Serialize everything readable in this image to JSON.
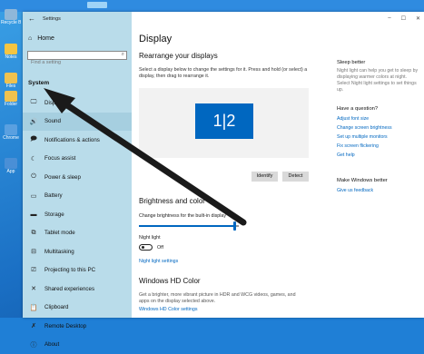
{
  "desktop": {
    "icons": [
      {
        "label": "Recycle Bin",
        "color": "#8fb7d9"
      },
      {
        "label": "Notes",
        "color": "#f5c542"
      },
      {
        "label": "Files",
        "color": "#f0c24f"
      },
      {
        "label": "Folder",
        "color": "#f0c24f"
      },
      {
        "label": "Chrome",
        "color": "#5aa0e0"
      },
      {
        "label": "App",
        "color": "#4a8fd6"
      }
    ]
  },
  "window": {
    "app_title": "Settings",
    "controls": {
      "minimize": "–",
      "maximize": "☐",
      "close": "✕"
    }
  },
  "sidebar": {
    "home_label": "Home",
    "search_placeholder": "Find a setting",
    "section_label": "System",
    "items": [
      {
        "label": "Display",
        "icon": "display-icon",
        "glyph": "🖵"
      },
      {
        "label": "Sound",
        "icon": "sound-icon",
        "glyph": "🔊"
      },
      {
        "label": "Notifications & actions",
        "icon": "notifications-icon",
        "glyph": "🗩"
      },
      {
        "label": "Focus assist",
        "icon": "moon-icon",
        "glyph": "☾"
      },
      {
        "label": "Power & sleep",
        "icon": "power-icon",
        "glyph": "⏻"
      },
      {
        "label": "Battery",
        "icon": "battery-icon",
        "glyph": "▭"
      },
      {
        "label": "Storage",
        "icon": "storage-icon",
        "glyph": "▬"
      },
      {
        "label": "Tablet mode",
        "icon": "tablet-icon",
        "glyph": "⧉"
      },
      {
        "label": "Multitasking",
        "icon": "multitasking-icon",
        "glyph": "⊟"
      },
      {
        "label": "Projecting to this PC",
        "icon": "projecting-icon",
        "glyph": "⎚"
      },
      {
        "label": "Shared experiences",
        "icon": "shared-icon",
        "glyph": "✕"
      },
      {
        "label": "Clipboard",
        "icon": "clipboard-icon",
        "glyph": "📋"
      },
      {
        "label": "Remote Desktop",
        "icon": "remote-desktop-icon",
        "glyph": "✗"
      },
      {
        "label": "About",
        "icon": "info-icon",
        "glyph": "ⓘ"
      }
    ],
    "active_index": 1
  },
  "main": {
    "title": "Display",
    "rearrange_heading": "Rearrange your displays",
    "rearrange_desc": "Select a display below to change the settings for it. Press and hold (or select) a display, then drag to rearrange it.",
    "monitor_label": "1|2",
    "identify_label": "Identify",
    "detect_label": "Detect",
    "brightness_heading": "Brightness and color",
    "brightness_label": "Change brightness for the built-in display",
    "brightness_value": 0.95,
    "night_light_label": "Night light",
    "night_light_state": "Off",
    "night_light_settings_link": "Night light settings",
    "hdr_heading": "Windows HD Color",
    "hdr_desc": "Get a brighter, more vibrant picture in HDR and WCG videos, games, and apps on the display selected above.",
    "hdr_link": "Windows HD Color settings"
  },
  "right_panel": {
    "sleep_heading": "Sleep better",
    "sleep_desc": "Night light can help you get to sleep by displaying warmer colors at night. Select Night light settings to set things up.",
    "question_heading": "Have a question?",
    "links": [
      "Adjust font size",
      "Change screen brightness",
      "Set up multiple monitors",
      "Fix screen flickering",
      "Get help"
    ],
    "better_heading": "Make Windows better",
    "feedback_link": "Give us feedback"
  },
  "colors": {
    "accent": "#0067c0",
    "sidebar": "#b9dcea",
    "arrow": "#1a1a1a"
  }
}
